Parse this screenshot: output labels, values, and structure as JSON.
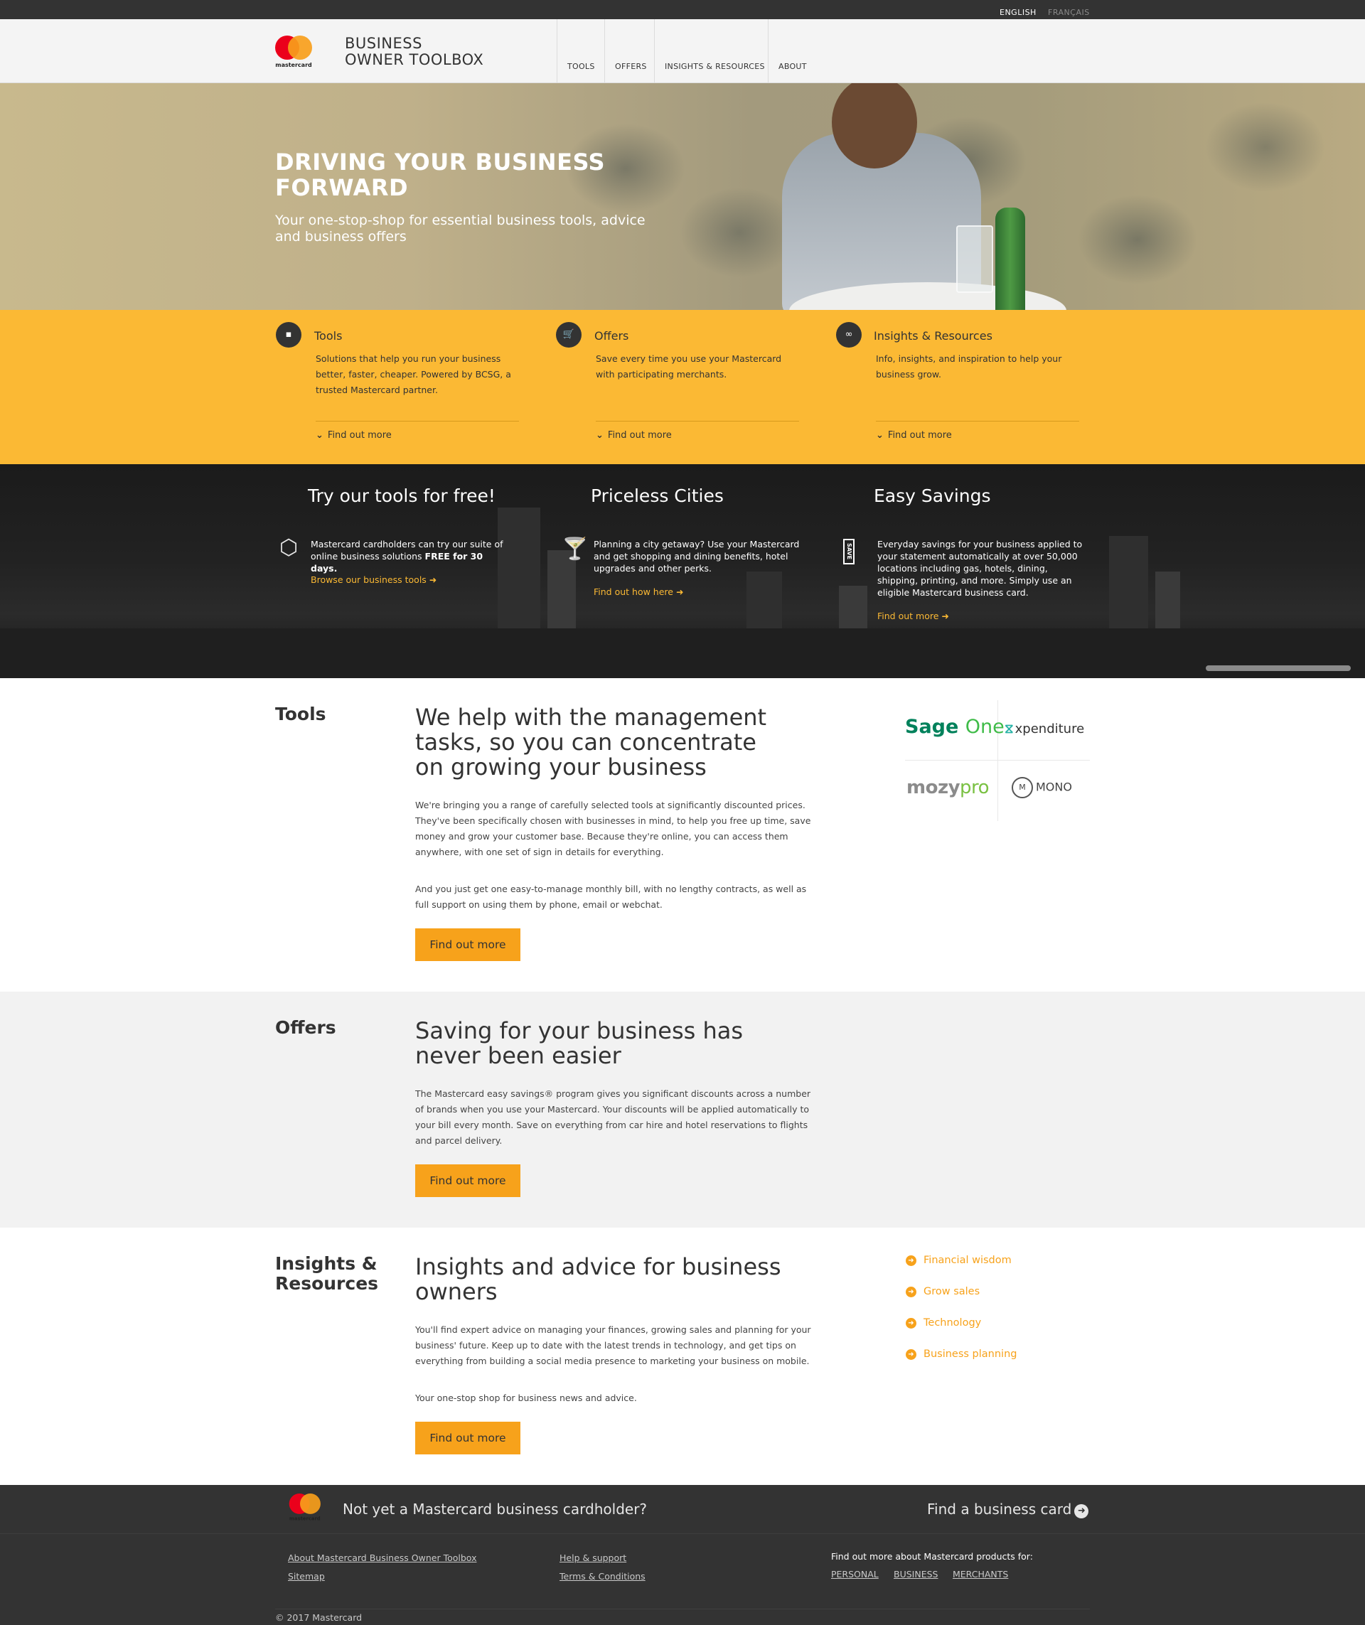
{
  "languages": {
    "english": "ENGLISH",
    "francais": "FRANÇAIS"
  },
  "header": {
    "logo_wordmark": "mastercard",
    "brand_line1": "BUSINESS",
    "brand_line2": "OWNER TOOLBOX",
    "nav": [
      "TOOLS",
      "OFFERS",
      "INSIGHTS & RESOURCES",
      "ABOUT"
    ]
  },
  "hero": {
    "title_line1": "DRIVING YOUR BUSINESS",
    "title_line2": "FORWARD",
    "subtitle": "Your one-stop-shop for essential business tools, advice and business offers"
  },
  "features": [
    {
      "icon": "briefcase-icon",
      "glyph": "▪",
      "title": "Tools",
      "desc": "Solutions that help you run your business better, faster, cheaper. Powered by BCSG, a trusted Mastercard partner.",
      "link": "Find out more"
    },
    {
      "icon": "cart-icon",
      "glyph": "🛒",
      "title": "Offers",
      "desc": "Save every time you use your Mastercard with participating merchants.",
      "link": "Find out more"
    },
    {
      "icon": "link-icon",
      "glyph": "∞",
      "title": "Insights & Resources",
      "desc": "Info, insights, and inspiration to help your business grow.",
      "link": "Find out more"
    }
  ],
  "promos": [
    {
      "icon": "box-icon",
      "title": "Try our tools for free!",
      "desc_plain": "Mastercard cardholders can try our suite of online business solutions ",
      "desc_bold": "FREE for 30 days.",
      "link": "Browse our business tools"
    },
    {
      "icon": "cocktail-icon",
      "title": "Priceless Cities",
      "desc_plain": "Planning a city getaway? Use your Mastercard and get shopping and dining benefits, hotel upgrades and other perks.",
      "desc_bold": "",
      "link": "Find out how here"
    },
    {
      "icon": "save-tag-icon",
      "save_label": "SAVE",
      "title": "Easy Savings",
      "desc_plain": "Everyday savings for your business applied to your statement automatically at over 50,000 locations including gas, hotels, dining, shipping, printing, and more. Simply use an eligible Mastercard business card.",
      "desc_bold": "",
      "link": "Find out more"
    }
  ],
  "tools": {
    "label": "Tools",
    "heading": "We help with the management tasks, so you can concentrate on growing your business",
    "p1": "We're bringing you a range of carefully selected tools at significantly discounted prices. They've been specifically chosen with businesses in mind, to help you free up time, save money and grow your customer base. Because they're online, you can access them anywhere, with one set of sign in details for everything.",
    "p2": "And you just get one easy-to-manage monthly bill, with no lengthy contracts, as well as full support on using them by phone, email or webchat.",
    "button": "Find out more",
    "partners": {
      "sage_a": "Sage",
      "sage_b": "One",
      "xpend": "xpenditure",
      "mozy_a": "mozy",
      "mozy_b": "pro",
      "mono": "MONO"
    }
  },
  "offers": {
    "label": "Offers",
    "heading": "Saving for your business has never been easier",
    "p1": "The Mastercard easy savings® program gives you significant discounts across a number of brands when you use your Mastercard. Your discounts will be applied automatically to your bill every month. Save on everything from car hire and hotel reservations to flights and parcel delivery.",
    "button": "Find out more"
  },
  "insights": {
    "label_line1": "Insights &",
    "label_line2": "Resources",
    "heading": "Insights and advice for business owners",
    "p1": "You'll find expert advice on managing your finances, growing sales and planning for your business' future. Keep up to date with the latest trends in technology, and get tips on everything from building a social media presence to marketing your business on mobile.",
    "p2": "Your one-stop shop for business news and advice.",
    "button": "Find out more",
    "links": [
      "Financial wisdom",
      "Grow sales",
      "Technology",
      "Business planning"
    ]
  },
  "cta": {
    "text": "Not yet a Mastercard business cardholder?",
    "link": "Find a business card"
  },
  "footer": {
    "col1": [
      "About Mastercard Business Owner Toolbox",
      "Sitemap"
    ],
    "col2": [
      "Help & support",
      "Terms & Conditions"
    ],
    "products_heading": "Find out more about Mastercard products for:",
    "products": [
      "PERSONAL",
      "BUSINESS",
      "MERCHANTS"
    ],
    "copyright": "© 2017 Mastercard"
  }
}
